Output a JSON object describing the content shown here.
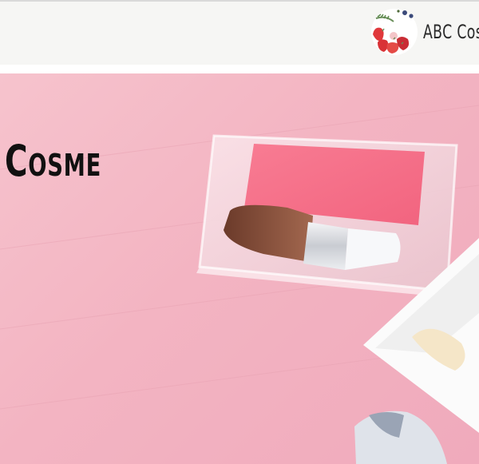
{
  "header": {
    "brand_name": "ABC Cosm",
    "logo_icon": "fruit-wreath-logo-icon"
  },
  "hero": {
    "title": "Cosme",
    "image": "pink-blush-compact-and-brush-photo",
    "colors": {
      "background": "#f3b4c2",
      "blush": "#f46b84"
    }
  }
}
